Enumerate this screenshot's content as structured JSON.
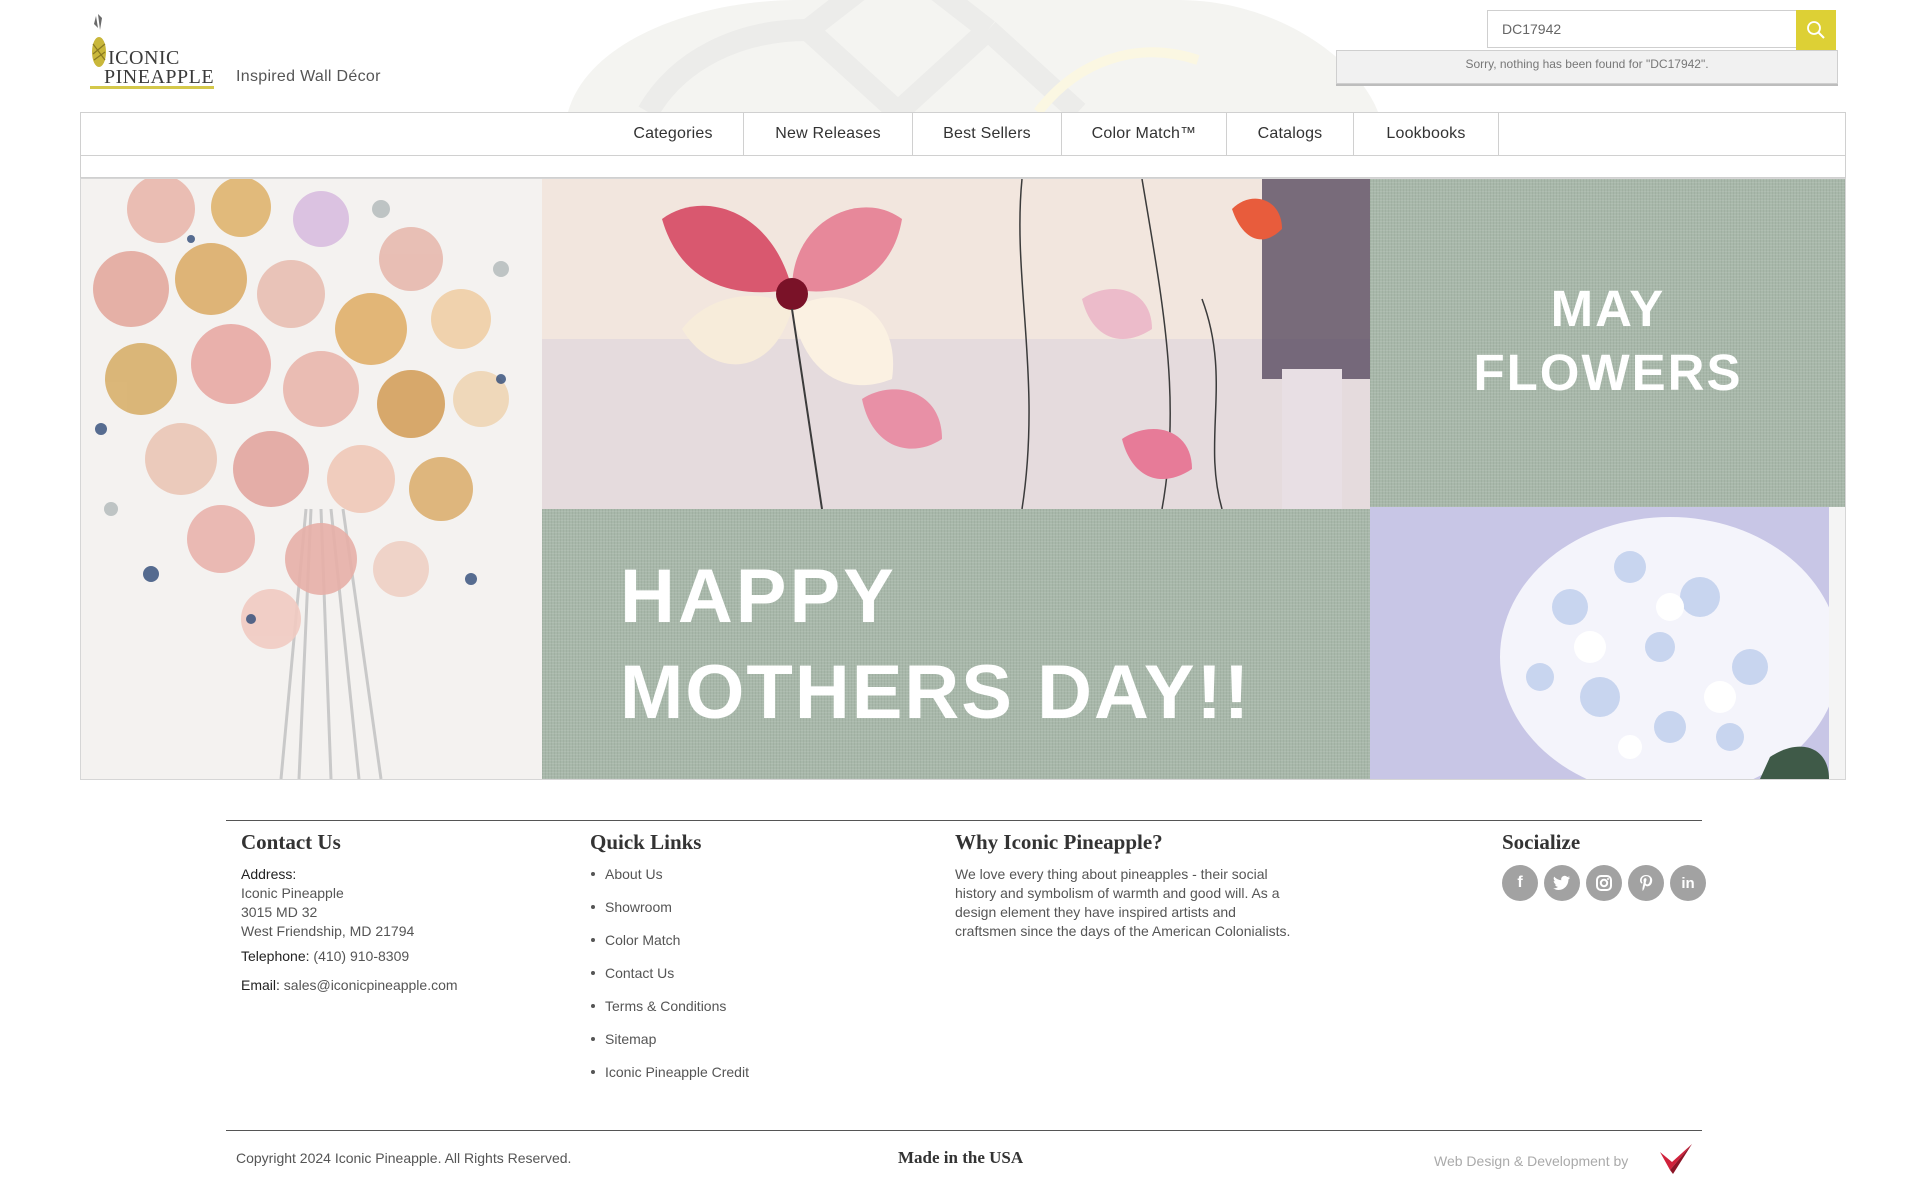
{
  "header": {
    "logo_line1": "ICONIC",
    "logo_line2": "PINEAPPLE",
    "tagline": "Inspired Wall Décor"
  },
  "search": {
    "value": "DC17942",
    "placeholder": "",
    "no_results": "Sorry, nothing has been found for \"DC17942\".",
    "button_icon": "search-icon"
  },
  "nav": {
    "items": [
      {
        "label": "Categories"
      },
      {
        "label": "New Releases"
      },
      {
        "label": "Best Sellers"
      },
      {
        "label": "Color Match™"
      },
      {
        "label": "Catalogs"
      },
      {
        "label": "Lookbooks"
      }
    ]
  },
  "banner": {
    "may_line1": "MAY",
    "may_line2": "FLOWERS",
    "mothers_line1": "HAPPY",
    "mothers_line2": "MOTHERS DAY!!"
  },
  "footer": {
    "contact": {
      "heading": "Contact Us",
      "address_label": "Address:",
      "address_lines": [
        "Iconic Pineapple",
        "3015 MD 32",
        "West Friendship, MD 21794"
      ],
      "telephone_label": "Telephone:",
      "telephone": "(410) 910-8309",
      "email_label": "Email:",
      "email": "sales@iconicpineapple.com"
    },
    "quick_links": {
      "heading": "Quick Links",
      "items": [
        "About Us",
        "Showroom",
        "Color Match",
        "Contact Us",
        "Terms & Conditions",
        "Sitemap",
        "Iconic Pineapple Credit"
      ]
    },
    "why": {
      "heading": "Why Iconic Pineapple?",
      "text": "We love every thing about pineapples - their social history and symbolism of warmth and good will. As a design element they have inspired artists and craftsmen since the days of the American Colonialists."
    },
    "social": {
      "heading": "Socialize",
      "icons": [
        "facebook-icon",
        "twitter-icon",
        "instagram-icon",
        "pinterest-icon",
        "linkedin-icon"
      ]
    },
    "copyright": "Copyright 2024 Iconic Pineapple. All Rights Reserved.",
    "made_in": "Made in the USA",
    "web_design": "Web Design & Development by"
  },
  "colors": {
    "accent_yellow": "#ddd035",
    "banner_green": "#a8b8aa",
    "social_gray": "#a2a2a2"
  }
}
